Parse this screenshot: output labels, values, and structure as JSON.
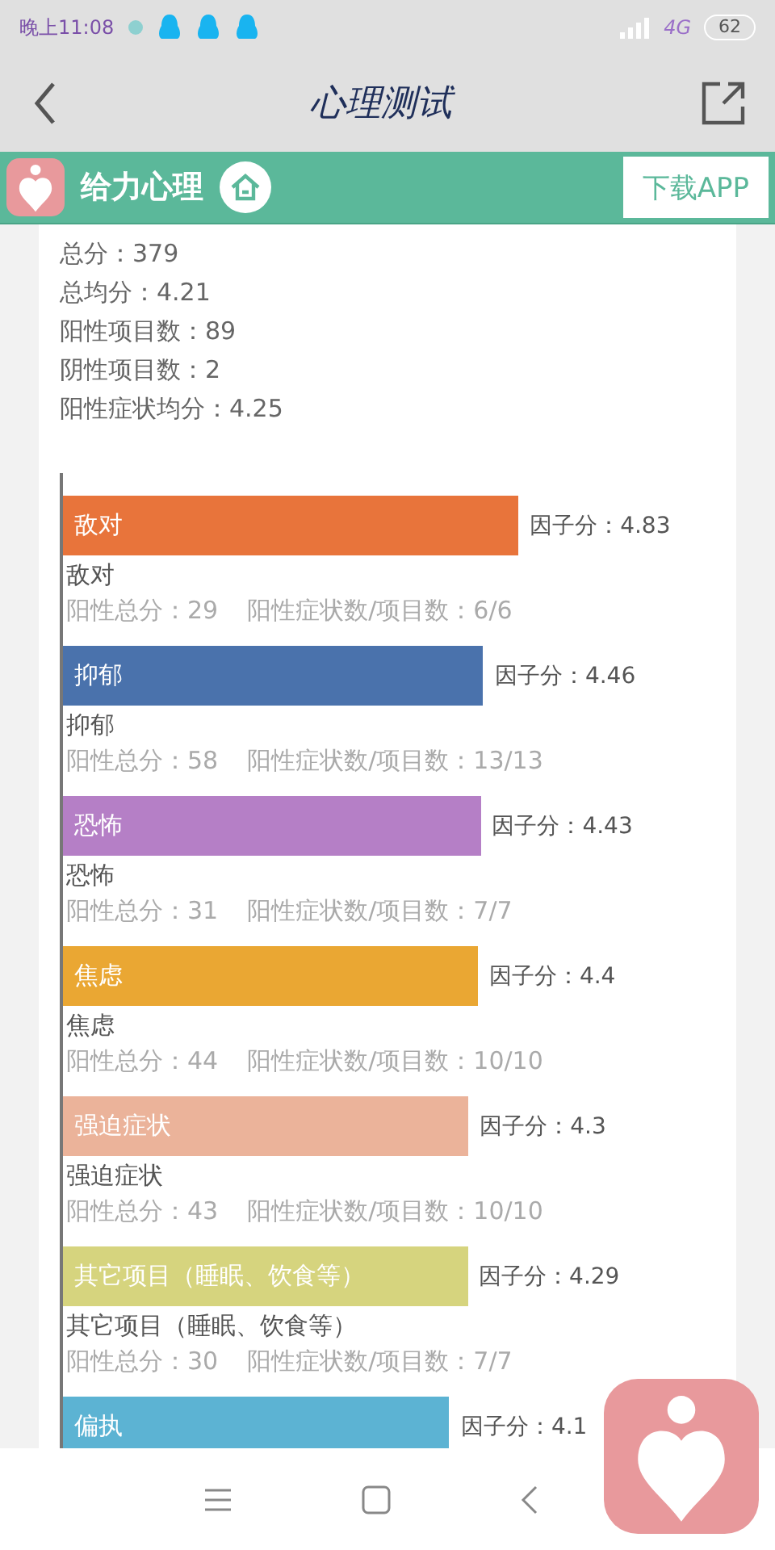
{
  "status_bar": {
    "time": "晚上11:08",
    "network": "4G",
    "battery": "62"
  },
  "title_bar": {
    "title": "心理测试"
  },
  "brand_bar": {
    "name": "给力心理",
    "download_button": "下载APP"
  },
  "summary": [
    "总分：379",
    "总均分：4.21",
    "阳性项目数：89",
    "阴性项目数：2",
    "阳性症状均分：4.25"
  ],
  "factors": [
    {
      "name": "敌对",
      "color": "#e8743b",
      "score": "因子分：4.83",
      "caption": "敌对",
      "positive_total": "阳性总分：29",
      "ratio": "阳性症状数/项目数：6/6"
    },
    {
      "name": "抑郁",
      "color": "#4a72ac",
      "score": "因子分：4.46",
      "caption": "抑郁",
      "positive_total": "阳性总分：58",
      "ratio": "阳性症状数/项目数：13/13"
    },
    {
      "name": "恐怖",
      "color": "#b57fc6",
      "score": "因子分：4.43",
      "caption": "恐怖",
      "positive_total": "阳性总分：31",
      "ratio": "阳性症状数/项目数：7/7"
    },
    {
      "name": "焦虑",
      "color": "#eaa733",
      "score": "因子分：4.4",
      "caption": "焦虑",
      "positive_total": "阳性总分：44",
      "ratio": "阳性症状数/项目数：10/10"
    },
    {
      "name": "强迫症状",
      "color": "#ebb39a",
      "score": "因子分：4.3",
      "caption": "强迫症状",
      "positive_total": "阳性总分：43",
      "ratio": "阳性症状数/项目数：10/10"
    },
    {
      "name": "其它项目（睡眠、饮食等）",
      "color": "#d6d47e",
      "score": "因子分：4.29",
      "caption": "其它项目（睡眠、饮食等）",
      "positive_total": "阳性总分：30",
      "ratio": "阳性症状数/项目数：7/7"
    },
    {
      "name": "偏执",
      "color": "#5cb3d3",
      "score": "因子分：4.1"
    }
  ]
}
